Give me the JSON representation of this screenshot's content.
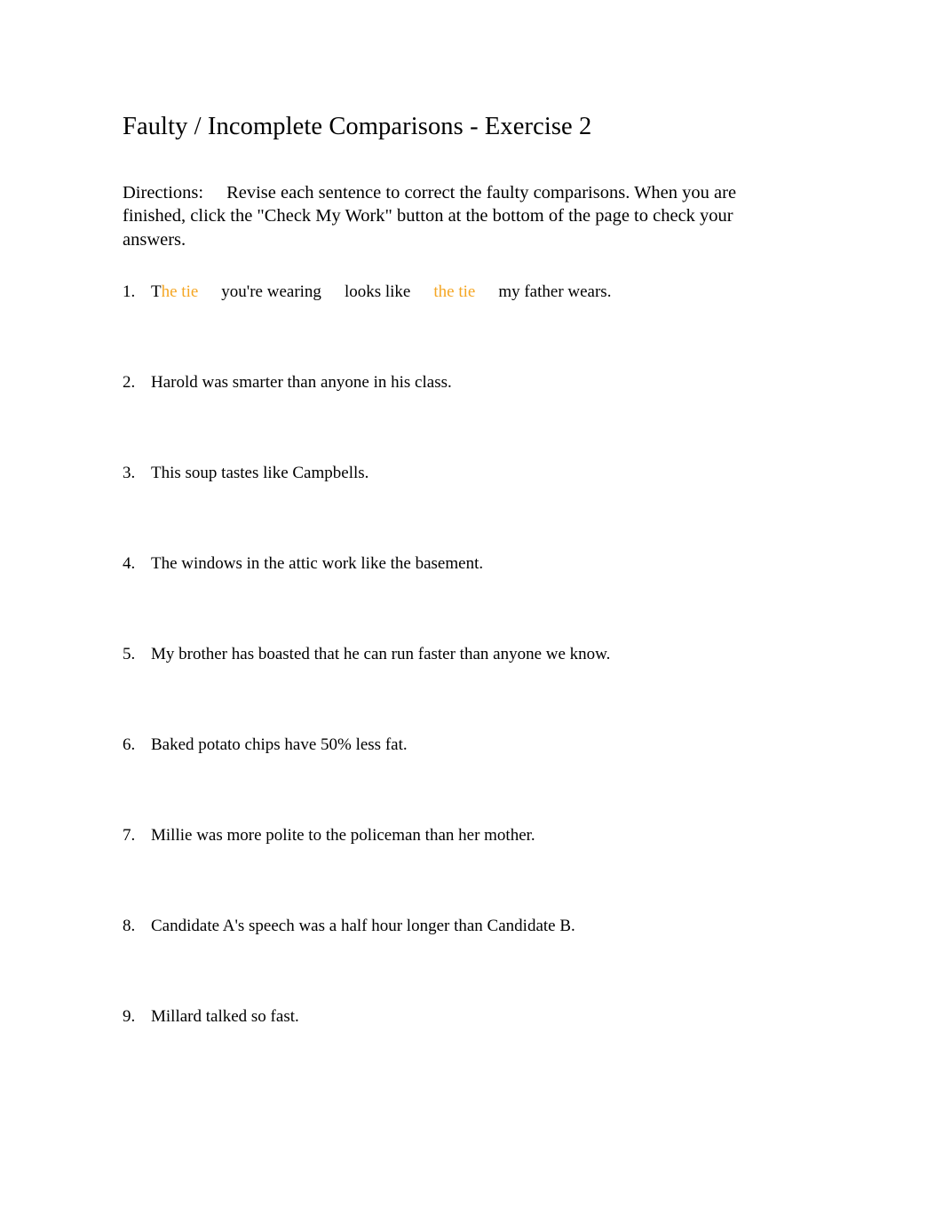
{
  "document": {
    "title": "Faulty / Incomplete Comparisons - Exercise 2",
    "directions_label": "Directions:",
    "directions_body": "Revise each sentence to correct the faulty comparisons. When you are finished, click the \"Check My Work\" button at the bottom of the page to check your answers.",
    "highlight_color": "#f5a623",
    "text_color": "#000000",
    "background_color": "#ffffff"
  },
  "items": [
    {
      "number": "1.",
      "text": "The tie you're wearing looks like the tie my father wears.",
      "segments": [
        {
          "text": "T",
          "color": "black"
        },
        {
          "text": "he tie",
          "color": "orange"
        },
        {
          "text": "  ",
          "color": "gap"
        },
        {
          "text": "you're wearing",
          "color": "black"
        },
        {
          "text": "  ",
          "color": "gap"
        },
        {
          "text": "looks like",
          "color": "black"
        },
        {
          "text": "  ",
          "color": "gap"
        },
        {
          "text": "the tie",
          "color": "orange"
        },
        {
          "text": "  ",
          "color": "gap"
        },
        {
          "text": "my father wears.",
          "color": "black"
        }
      ]
    },
    {
      "number": "2.",
      "text": "Harold was smarter than anyone in his class.",
      "segments": [
        {
          "text": "Harold was smarter than anyone in his class.",
          "color": "black"
        }
      ]
    },
    {
      "number": "3.",
      "text": "This soup tastes like Campbells.",
      "segments": [
        {
          "text": "This soup tastes like Campbells.",
          "color": "black"
        }
      ]
    },
    {
      "number": "4.",
      "text": "The windows in the attic work like the basement.",
      "segments": [
        {
          "text": "The windows in the attic work like the basement.",
          "color": "black"
        }
      ]
    },
    {
      "number": "5.",
      "text": "My brother has boasted that he can run faster than anyone we know.",
      "segments": [
        {
          "text": "My brother has boasted that he can run faster than anyone we know.",
          "color": "black"
        }
      ]
    },
    {
      "number": "6.",
      "text": "Baked potato chips have 50% less fat.",
      "segments": [
        {
          "text": "Baked potato chips have 50% less fat.",
          "color": "black"
        }
      ]
    },
    {
      "number": "7.",
      "text": "Millie was more polite to the policeman than her mother.",
      "segments": [
        {
          "text": "Millie was more polite to the policeman than her mother.",
          "color": "black"
        }
      ]
    },
    {
      "number": "8.",
      "text": "Candidate A's speech was a half hour longer than Candidate B.",
      "segments": [
        {
          "text": "Candidate A's speech was a half hour longer than Candidate B.",
          "color": "black"
        }
      ]
    },
    {
      "number": "9.",
      "text": "Millard talked so fast.",
      "segments": [
        {
          "text": "Millard talked so fast.",
          "color": "black"
        }
      ]
    }
  ]
}
